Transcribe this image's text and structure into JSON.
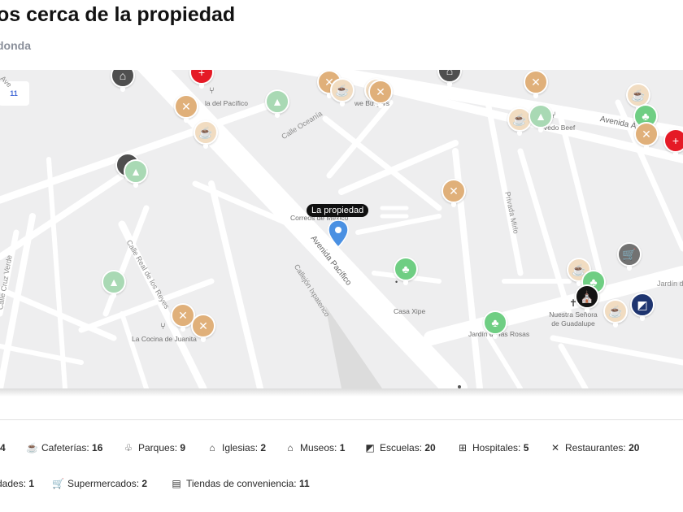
{
  "header": {
    "title": "os cerca de la propiedad",
    "subtitle": "donda"
  },
  "map": {
    "property_label": "La propiedad",
    "zoom_badge": "11",
    "streets": [
      "Calle Oceanía",
      "Avenida Pacífico",
      "Calle Real de los Reyes",
      "Callejón Ixpatenco",
      "Privada Mirlo",
      "Avenida Á",
      "Calle Cruz Verde",
      "Jardín de",
      "Ave"
    ],
    "places": [
      "la del Pacífico",
      "we Burgers",
      "Vedo Beef",
      "Correos de México",
      "Casa Xipe",
      "La Cocina de Juanita",
      "Jardín de las Rosas",
      "Nuestra Señora de Guadalupe"
    ]
  },
  "categories_row1": [
    {
      "label": "",
      "count": "4"
    },
    {
      "icon": "cafe-icon",
      "label": "Cafeterías:",
      "count": "16"
    },
    {
      "icon": "park-icon",
      "label": "Parques:",
      "count": "9"
    },
    {
      "icon": "church-icon",
      "label": "Iglesias:",
      "count": "2"
    },
    {
      "icon": "museum-icon",
      "label": "Museos:",
      "count": "1"
    },
    {
      "icon": "school-icon",
      "label": "Escuelas:",
      "count": "20"
    },
    {
      "icon": "hospital-icon",
      "label": "Hospitales:",
      "count": "5"
    },
    {
      "icon": "restaurant-icon",
      "label": "Restaurantes:",
      "count": "20"
    }
  ],
  "categories_row2": [
    {
      "label": "dades:",
      "count": "1"
    },
    {
      "icon": "cart-icon",
      "label": "Supermercados:",
      "count": "2"
    },
    {
      "icon": "store-icon",
      "label": "Tiendas de conveniencia:",
      "count": "11"
    }
  ],
  "colors": {
    "restaurant": "#e0b07a",
    "cafe": "#f1dcc1",
    "park": "#6fce83",
    "school": "#a9d9b4",
    "hospital": "#e51a26",
    "property": "#4a90e2"
  }
}
